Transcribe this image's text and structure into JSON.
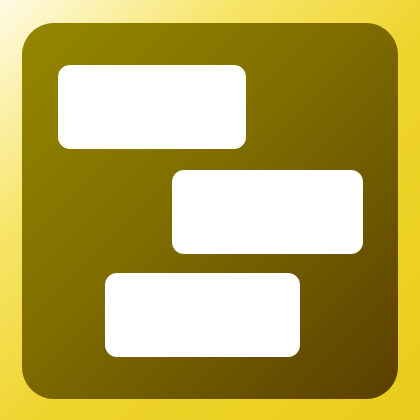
{
  "icon": {
    "name": "gantt-timeline-icon",
    "colors": {
      "background_light": "#fffbe6",
      "background_accent": "#efd42c",
      "tile_light": "#958700",
      "tile_dark": "#5a3f00",
      "bar_fill": "#ffffff"
    },
    "bars": [
      {
        "name": "bar-1"
      },
      {
        "name": "bar-2"
      },
      {
        "name": "bar-3"
      }
    ]
  }
}
